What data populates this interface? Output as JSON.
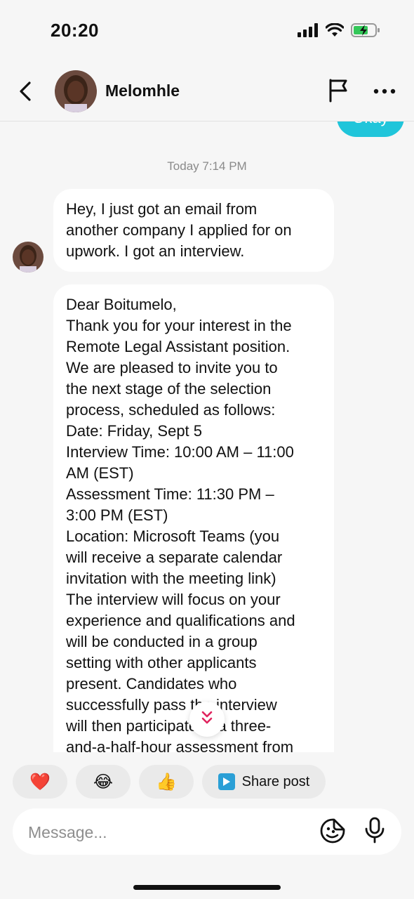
{
  "status_bar": {
    "time": "20:20"
  },
  "header": {
    "contact_name": "Melomhle",
    "back_icon": "chevron-left-icon",
    "flag_icon": "flag-icon",
    "more_icon": "more-horizontal-icon"
  },
  "chat": {
    "sent_partial": "Okay",
    "timestamp": "Today 7:14 PM",
    "messages": [
      {
        "lines": [
          "Hey, I just got an email from",
          "another company I applied for on",
          "upwork. I got an interview."
        ]
      },
      {
        "lines": [
          "Dear Boitumelo,",
          "Thank you for your interest in the",
          "Remote Legal Assistant position.",
          "We are pleased to invite you to",
          "the next stage of the selection",
          "process, scheduled as follows:",
          "Date: Friday, Sept 5",
          "Interview Time: 10:00 AM – 11:00",
          "AM (EST)",
          "Assessment Time: 11:30 PM –",
          "3:00 PM (EST)",
          "Location: Microsoft Teams (you",
          "will receive a separate calendar",
          "invitation with the meeting link)",
          "The interview will focus on your",
          "experience and qualifications and",
          "will be conducted in a group",
          "setting with other applicants",
          "present. Candidates who",
          "successfully pass the interview",
          "will then participate in a three-",
          "and-a-half-hour assessment from"
        ]
      }
    ]
  },
  "quick_reactions": [
    {
      "emoji": "❤️",
      "icon": "heart-icon"
    },
    {
      "emoji": "😂",
      "icon": "laughing-face-icon"
    },
    {
      "emoji": "👍",
      "icon": "thumbs-up-icon"
    }
  ],
  "share_post": {
    "label": "Share post",
    "icon": "play-icon",
    "icon_color": "#2a9fd6"
  },
  "composer": {
    "placeholder": "Message...",
    "sticker_icon": "sticker-icon",
    "mic_icon": "microphone-icon"
  },
  "colors": {
    "sent_bubble": "#20c5da",
    "battery": "#34c759",
    "scroll_chevron": "#e0245e"
  }
}
